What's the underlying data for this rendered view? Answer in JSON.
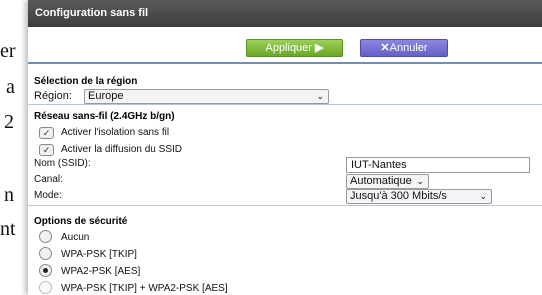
{
  "background_doc": {
    "fragments": [
      "er",
      "a",
      "2",
      "n",
      "nt"
    ]
  },
  "window": {
    "title": "Configuration sans fil"
  },
  "toolbar": {
    "apply_label": "Appliquer ",
    "apply_icon": "▶",
    "cancel_icon": "✕",
    "cancel_label": "Annuler"
  },
  "region": {
    "title": "Sélection de la région",
    "label": "Région:",
    "value": "Europe"
  },
  "wireless": {
    "title": "Réseau sans-fil (2.4GHz b/gn)",
    "isolation_label": "Activer l'isolation sans fil",
    "isolation_checked": true,
    "ssid_broadcast_label": "Activer la diffusion du SSID",
    "ssid_broadcast_checked": true,
    "ssid_label": "Nom (SSID):",
    "ssid_value": "IUT-Nantes",
    "channel_label": "Canal:",
    "channel_value": "Automatique",
    "mode_label": "Mode:",
    "mode_value": "Jusqu'à 300 Mbits/s"
  },
  "security": {
    "title": "Options de sécurité",
    "options": [
      {
        "label": "Aucun",
        "selected": false
      },
      {
        "label": "WPA-PSK [TKIP]",
        "selected": false
      },
      {
        "label": "WPA2-PSK [AES]",
        "selected": true
      },
      {
        "label": "WPA-PSK [TKIP] + WPA2-PSK [AES]",
        "selected": false
      }
    ]
  }
}
